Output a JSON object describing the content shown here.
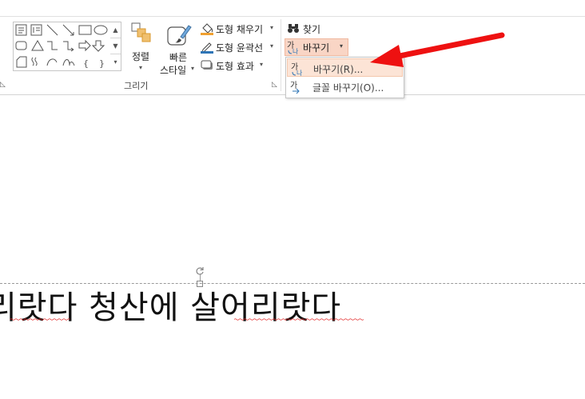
{
  "ribbon": {
    "drawing_group": {
      "label": "그리기",
      "arrange_label": "정렬",
      "quick_styles_label_1": "빠른",
      "quick_styles_label_2": "스타일",
      "shape_fill_label": "도형 채우기",
      "shape_outline_label": "도형 윤곽선",
      "shape_effects_label": "도형 효과"
    },
    "editing_group": {
      "find_label": "찾기",
      "replace_label": "바꾸기"
    }
  },
  "replace_menu": {
    "items": [
      {
        "label": "바꾸기(R)...",
        "highlighted": true
      },
      {
        "label": "글꼴 바꾸기(O)...",
        "highlighted": false
      }
    ]
  },
  "slide": {
    "text": "리랏다 청산에 살어리랏다"
  },
  "colors": {
    "arrow": "#ee1111",
    "highlight": "#f9d5c5",
    "fill_swatch": "#f0a030",
    "outline_swatch": "#2e75b6"
  }
}
